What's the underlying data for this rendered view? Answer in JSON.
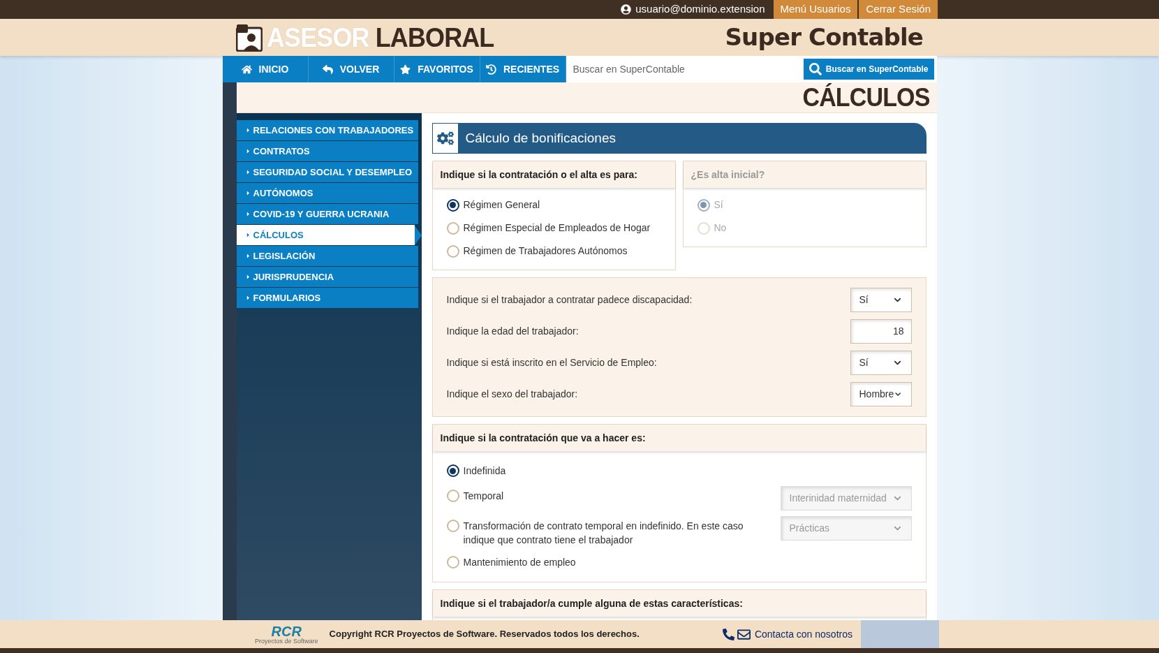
{
  "top_bar": {
    "user": "usuario@dominio.extension",
    "buttons": [
      "Menú Usuarios",
      "Cerrar Sesión"
    ]
  },
  "header": {
    "logo": [
      "ASESOR",
      "LABORAL"
    ],
    "brand": "Super Contable"
  },
  "nav": {
    "items": [
      "INICIO",
      "VOLVER",
      "FAVORITOS",
      "RECIENTES"
    ],
    "search": {
      "placeholder": "Buscar en SuperContable"
    },
    "search_button": "Buscar en SuperContable"
  },
  "page_title": "CÁLCULOS",
  "sidebar": {
    "items": [
      {
        "label": "RELACIONES CON TRABAJADORES",
        "selected": false
      },
      {
        "label": "CONTRATOS",
        "selected": false
      },
      {
        "label": "SEGURIDAD SOCIAL Y DESEMPLEO",
        "selected": false
      },
      {
        "label": "AUTÓNOMOS",
        "selected": false
      },
      {
        "label": "COVID-19 Y GUERRA UCRANIA",
        "selected": false
      },
      {
        "label": "CÁLCULOS",
        "selected": true
      },
      {
        "label": "LEGISLACIÓN",
        "selected": false
      },
      {
        "label": "JURISPRUDENCIA",
        "selected": false
      },
      {
        "label": "FORMULARIOS",
        "selected": false
      }
    ]
  },
  "panel": {
    "title": "Cálculo de bonificaciones",
    "regime": {
      "heading": "Indique si la contratación o el alta es para:",
      "disabled": false,
      "options": [
        {
          "label": "Régimen General",
          "selected": true
        },
        {
          "label": "Régimen Especial de Empleados de Hogar",
          "selected": false
        },
        {
          "label": "Régimen de Trabajadores Autónomos",
          "selected": false
        }
      ]
    },
    "initial": {
      "heading": "¿Es alta inicial?",
      "disabled": true,
      "options": [
        {
          "label": "Sí",
          "selected": true
        },
        {
          "label": "No",
          "selected": false
        }
      ]
    },
    "fields": [
      {
        "label": "Indique si el trabajador a contratar padece discapacidad:",
        "kind": "select",
        "value": "Sí"
      },
      {
        "label": "Indique la edad del trabajador:",
        "kind": "input",
        "value": "18"
      },
      {
        "label": "Indique si está inscrito en el Servicio de Empleo:",
        "kind": "select",
        "value": "Sí"
      },
      {
        "label": "Indique el sexo del trabajador:",
        "kind": "select",
        "value": "Hombre"
      }
    ],
    "contract": {
      "heading": "Indique si la contratación que va a hacer es:",
      "options": [
        {
          "label": "Indefinida",
          "selected": true
        },
        {
          "label": "Temporal",
          "selected": false,
          "select": {
            "value": "Interinidad maternidad",
            "disabled": true
          }
        },
        {
          "label": "Transformación de contrato temporal en indefinido. En este caso indique que contrato tiene el trabajador",
          "selected": false,
          "select": {
            "value": "Prácticas",
            "disabled": true
          }
        },
        {
          "label": "Mantenimiento de empleo",
          "selected": false
        }
      ]
    },
    "characteristics": {
      "heading": "Indique si el trabajador/a cumple alguna de estas características:"
    }
  },
  "footer": {
    "logo": "RCR",
    "logo_caption": "Proyectos de Software",
    "copyright": "Copyright RCR Proyectos de Software. Reservados todos los derechos.",
    "contact": "Contacta con nosotros"
  }
}
